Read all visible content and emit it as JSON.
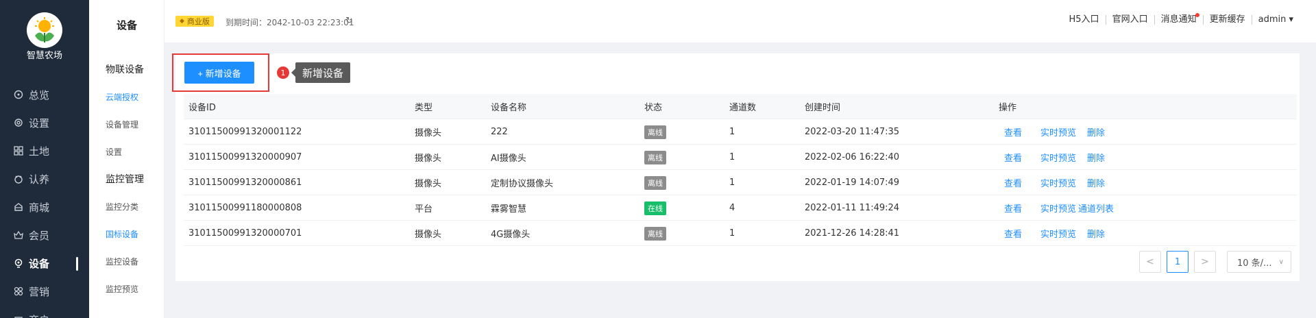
{
  "app": {
    "logo_text": "智慧农场",
    "colors": {
      "sidebar_bg": "#1f2a3a",
      "accent": "#1e8fff",
      "offline": "#8c8c8c",
      "online": "#19be6b",
      "highlight": "#e53935"
    }
  },
  "sidebar": {
    "items": [
      {
        "label": "总览",
        "icon": "dashboard-icon"
      },
      {
        "label": "设置",
        "icon": "gear-icon"
      },
      {
        "label": "土地",
        "icon": "grid-icon"
      },
      {
        "label": "认养",
        "icon": "adopt-icon"
      },
      {
        "label": "商城",
        "icon": "shop-icon"
      },
      {
        "label": "会员",
        "icon": "member-icon"
      },
      {
        "label": "设备",
        "icon": "device-icon"
      },
      {
        "label": "营销",
        "icon": "marketing-icon"
      },
      {
        "label": "商户",
        "icon": "merchant-icon"
      }
    ]
  },
  "subbar": {
    "title": "设备",
    "groups": [
      {
        "label": "物联设备",
        "items": [
          "云端授权",
          "设备管理",
          "设置"
        ]
      },
      {
        "label": "监控管理",
        "items": [
          "监控分类",
          "国标设备",
          "监控设备",
          "监控预览"
        ]
      }
    ]
  },
  "header": {
    "badge": "商业版",
    "expire": "到期时间：2042-10-03 22:23:01",
    "links": [
      "H5入口",
      "官网入口",
      "消息通知",
      "更新缓存",
      "admin ▾"
    ]
  },
  "toolbar": {
    "add_label": "+ 新增设备",
    "step_number": "1",
    "tooltip": "新增设备"
  },
  "table": {
    "columns": [
      "设备ID",
      "类型",
      "设备名称",
      "状态",
      "通道数",
      "创建时间",
      "操作"
    ],
    "rows": [
      {
        "id": "31011500991320001122",
        "type": "摄像头",
        "name": "222",
        "status": "离线",
        "channels": "1",
        "created": "2022-03-20 11:47:35",
        "ops": [
          "查看",
          "实时预览",
          "删除"
        ]
      },
      {
        "id": "31011500991320000907",
        "type": "摄像头",
        "name": "AI摄像头",
        "status": "离线",
        "channels": "1",
        "created": "2022-02-06 16:22:40",
        "ops": [
          "查看",
          "实时预览",
          "删除"
        ]
      },
      {
        "id": "31011500991320000861",
        "type": "摄像头",
        "name": "定制协议摄像头",
        "status": "离线",
        "channels": "1",
        "created": "2022-01-19 14:07:49",
        "ops": [
          "查看",
          "实时预览",
          "删除"
        ]
      },
      {
        "id": "31011500991180000808",
        "type": "平台",
        "name": "霖雾智慧",
        "status": "在线",
        "channels": "4",
        "created": "2022-01-11 11:49:24",
        "ops": [
          "查看",
          "实时预览",
          "通道列表"
        ]
      },
      {
        "id": "31011500991320000701",
        "type": "摄像头",
        "name": "4G摄像头",
        "status": "离线",
        "channels": "1",
        "created": "2021-12-26 14:28:41",
        "ops": [
          "查看",
          "实时预览",
          "删除"
        ]
      }
    ]
  },
  "pagination": {
    "prev": "<",
    "current": "1",
    "next": ">",
    "page_size": "10 条/..."
  }
}
